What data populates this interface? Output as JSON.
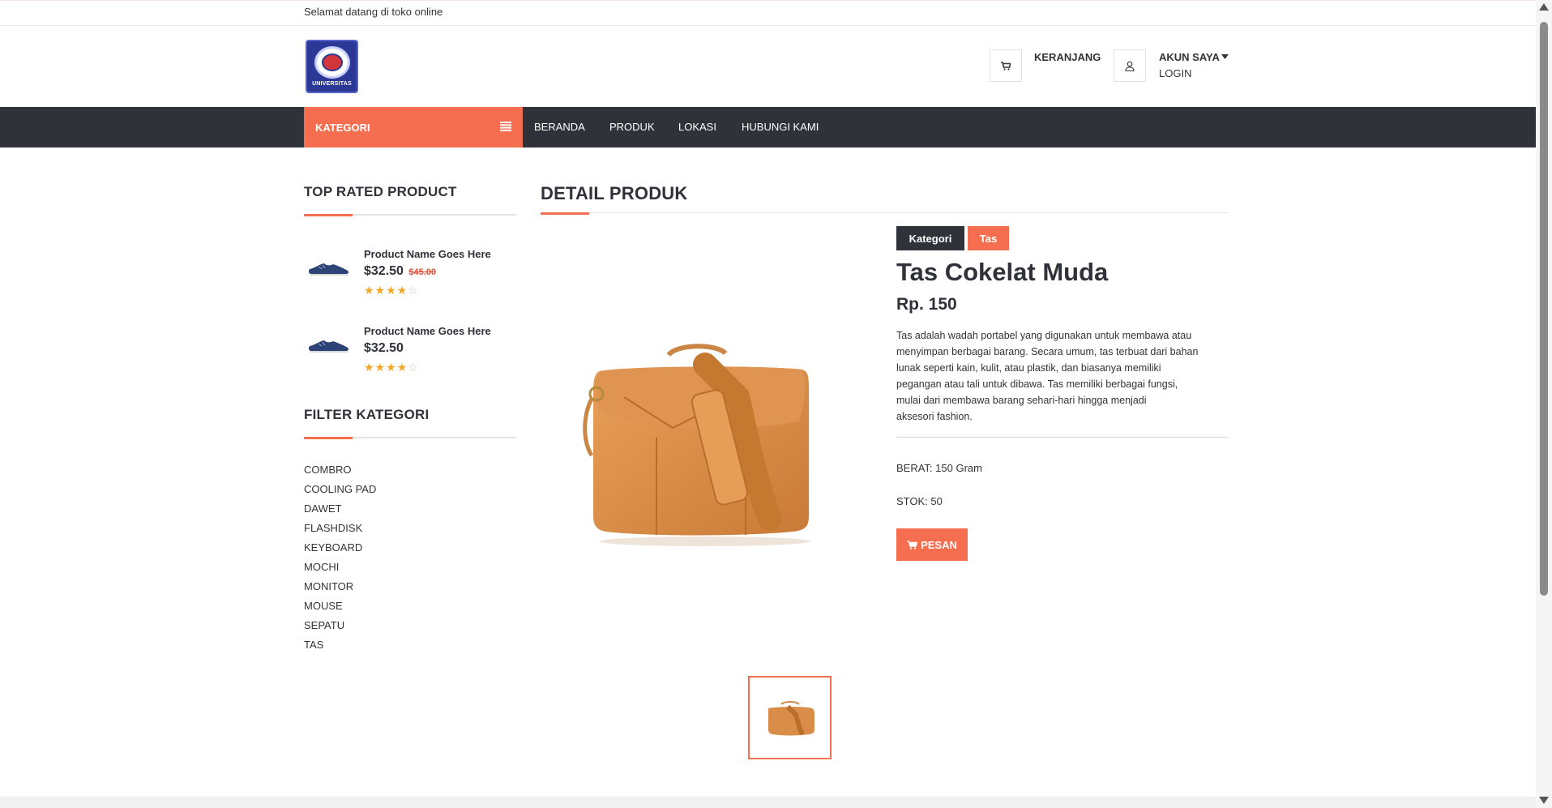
{
  "topbar": {
    "welcome": "Selamat datang di toko online"
  },
  "header": {
    "logo_text": "UNIVERSITAS",
    "cart_label": "KERANJANG",
    "account_label": "AKUN SAYA",
    "login_label": "LOGIN"
  },
  "nav": {
    "kategori_label": "KATEGORI",
    "items": [
      "BERANDA",
      "PRODUK",
      "LOKASI",
      "HUBUNGI KAMI"
    ]
  },
  "sidebar": {
    "top_rated_title": "TOP RATED PRODUCT",
    "top_rated": [
      {
        "name": "Product Name Goes Here",
        "price": "$32.50",
        "old_price": "$45.00",
        "rating": 4
      },
      {
        "name": "Product Name Goes Here",
        "price": "$32.50",
        "old_price": "",
        "rating": 4
      }
    ],
    "filter_title": "FILTER KATEGORI",
    "categories": [
      "COMBRO",
      "COOLING PAD",
      "DAWET",
      "FLASHDISK",
      "KEYBOARD",
      "MOCHI",
      "MONITOR",
      "MOUSE",
      "SEPATU",
      "TAS"
    ]
  },
  "product": {
    "section_title": "DETAIL PRODUK",
    "tag_label": "Kategori",
    "tag_value": "Tas",
    "name": "Tas Cokelat Muda",
    "price": "Rp. 150",
    "description_lines": [
      "Tas adalah wadah portabel yang digunakan untuk membawa atau",
      "menyimpan berbagai barang. Secara umum, tas terbuat dari bahan",
      "lunak seperti kain, kulit, atau plastik, dan biasanya memiliki",
      "pegangan atau tali untuk dibawa. Tas memiliki berbagai fungsi,",
      "mulai dari membawa barang sehari-hari hingga menjadi",
      "aksesori fashion."
    ],
    "weight": "BERAT: 150 Gram",
    "stock": "STOK: 50",
    "order_label": "PESAN"
  },
  "colors": {
    "accent": "#f46e4f",
    "dark": "#2f3339",
    "star": "#f5a623"
  }
}
